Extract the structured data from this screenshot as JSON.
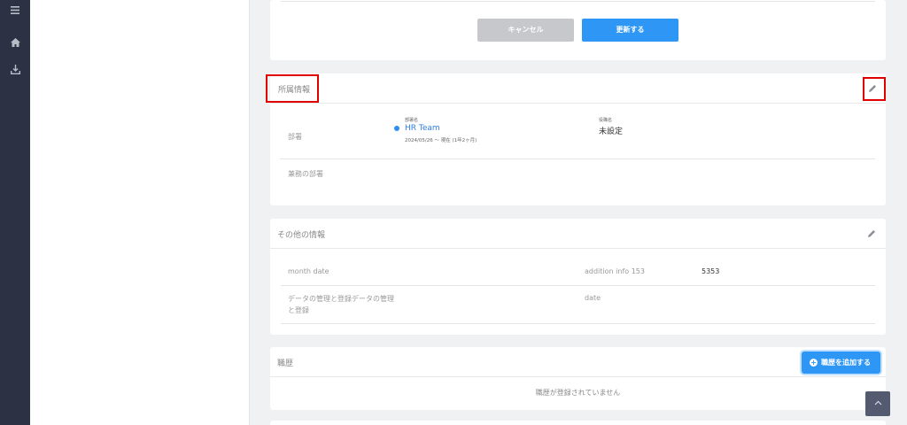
{
  "actions": {
    "cancel_label": "キャンセル",
    "update_label": "更新する"
  },
  "affiliation": {
    "title": "所属情報",
    "department_label": "部署",
    "dept_col_label": "部署名",
    "dept_name": "HR Team",
    "dept_period": "2024/05/26 〜 現在 (1年2ヶ月)",
    "position_col_label": "役職名",
    "position_value": "未設定",
    "concurrent_label": "兼務の部署"
  },
  "other_info": {
    "title": "その他の情報",
    "month_date_label": "month date",
    "addition_info_label": "addition info 153",
    "addition_info_value": "5353",
    "data_mgmt_label_line1": "データの管理と登録データの管理",
    "data_mgmt_label_line2": "と登録",
    "date_label": "date"
  },
  "history": {
    "title": "職歴",
    "add_button_label": "職歴を追加する",
    "empty_text": "職歴が登録されていません"
  },
  "icons": {
    "rail": [
      "menu-icon",
      "home-icon",
      "download-icon"
    ],
    "edit": "pencil-icon",
    "add": "plus-circle-icon",
    "scroll_top": "chevron-up-icon"
  },
  "colors": {
    "primary": "#2e97f5",
    "rail_bg": "#2c3244",
    "highlight": "#e00000"
  }
}
